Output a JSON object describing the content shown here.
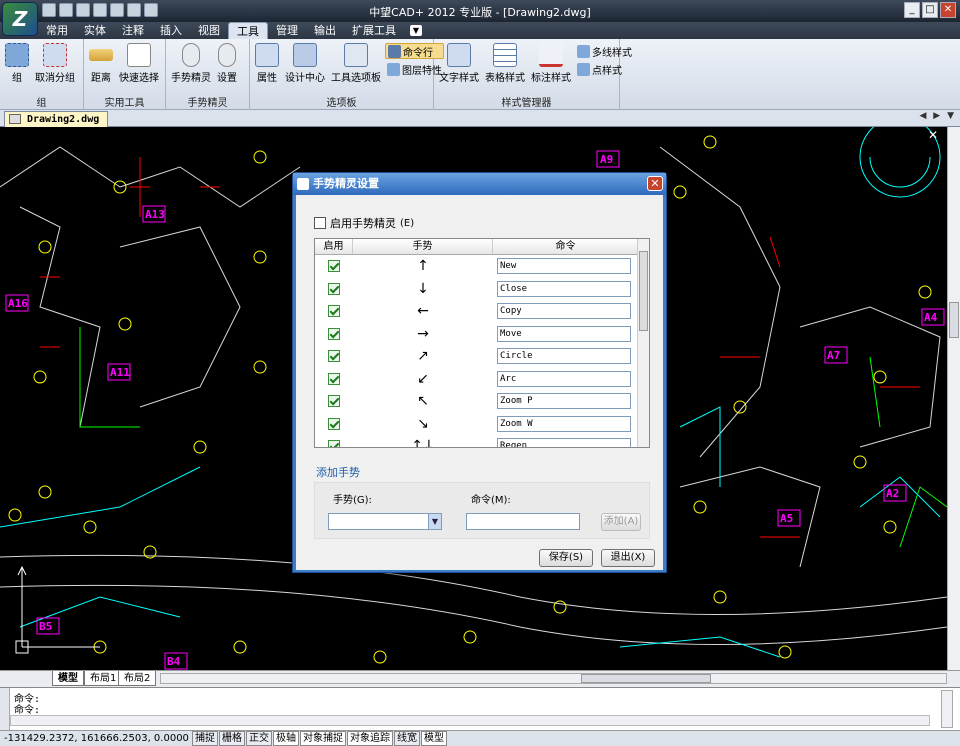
{
  "app": {
    "title": "中望CAD+ 2012 专业版 - [Drawing2.dwg]",
    "logo": "Z"
  },
  "ribbon_tabs": [
    "常用",
    "实体",
    "注释",
    "插入",
    "视图",
    "工具",
    "管理",
    "输出",
    "扩展工具"
  ],
  "active_tab": "工具",
  "ribbon": {
    "groups": [
      {
        "title": "组",
        "buttons": [
          "组",
          "取消分组"
        ]
      },
      {
        "title": "实用工具",
        "buttons": [
          "距离",
          "快速选择"
        ]
      },
      {
        "title": "手势精灵",
        "buttons": [
          "手势精灵",
          "设置"
        ]
      },
      {
        "title": "选项板",
        "buttons": [
          "属性",
          "设计中心",
          "工具选项板"
        ],
        "small": [
          "命令行",
          "图层特性"
        ]
      },
      {
        "title": "样式管理器",
        "buttons": [
          "文字样式",
          "表格样式",
          "标注样式"
        ],
        "small": [
          "多线样式",
          "点样式"
        ]
      }
    ]
  },
  "document": {
    "tab": "Drawing2.dwg"
  },
  "layouts": {
    "tabs": [
      "模型",
      "布局1",
      "布局2"
    ],
    "active": "模型"
  },
  "command": {
    "lines": [
      "命令:",
      "命令:"
    ]
  },
  "status": {
    "coords": "-131429.2372,  161666.2503,  0.0000",
    "toggles": [
      "捕捉",
      "栅格",
      "正交",
      "极轴",
      "对象捕捉",
      "对象追踪",
      "线宽",
      "模型"
    ]
  },
  "dialog": {
    "title": "手势精灵设置",
    "enable_label": "启用手势精灵",
    "enable_key": "(E)",
    "table": {
      "headers": [
        "启用",
        "手势",
        "命令"
      ],
      "rows": [
        {
          "enabled": true,
          "gesture": "↑",
          "command": "New"
        },
        {
          "enabled": true,
          "gesture": "↓",
          "command": "Close"
        },
        {
          "enabled": true,
          "gesture": "←",
          "command": "Copy"
        },
        {
          "enabled": true,
          "gesture": "→",
          "command": "Move"
        },
        {
          "enabled": true,
          "gesture": "↗",
          "command": "Circle"
        },
        {
          "enabled": true,
          "gesture": "↙",
          "command": "Arc"
        },
        {
          "enabled": true,
          "gesture": "↖",
          "command": "Zoom P"
        },
        {
          "enabled": true,
          "gesture": "↘",
          "command": "Zoom W"
        },
        {
          "enabled": true,
          "gesture": "↑↓",
          "command": "Regen"
        }
      ]
    },
    "add_title": "添加手势",
    "gesture_label": "手势(G):",
    "command_label": "命令(M):",
    "add_button": "添加(A)",
    "save_button": "保存(S)",
    "exit_button": "退出(X)"
  },
  "drawing": {
    "labels_magenta": [
      "A13",
      "A9",
      "A16",
      "A11",
      "A7",
      "A4",
      "A2",
      "A5",
      "B5",
      "B4"
    ],
    "colors": {
      "bg": "#000000",
      "yellow": "#ffff00",
      "cyan": "#00ffff",
      "green": "#00ff00",
      "red": "#ff0000",
      "magenta": "#ff00ff",
      "white": "#ffffff"
    }
  }
}
